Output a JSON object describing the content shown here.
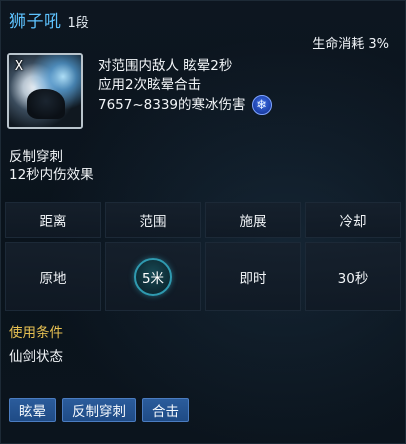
{
  "skill": {
    "name": "狮子吼",
    "level": "1段",
    "hp_cost": "生命消耗 3%",
    "icon_key": "X",
    "icon_name": "lion-roar-skill-icon",
    "description": [
      "对范围内敌人 眩晕2秒",
      "应用2次眩晕合击",
      "7657~8339的寒冰伤害"
    ],
    "damage_element_icon": "frost-icon",
    "effect_lines": [
      "反制穿刺",
      "12秒内伤效果"
    ]
  },
  "stats": {
    "headers": [
      "距离",
      "范围",
      "施展",
      "冷却"
    ],
    "values": [
      "原地",
      "5米",
      "即时",
      "30秒"
    ]
  },
  "condition": {
    "title": "使用条件",
    "text": "仙剑状态"
  },
  "tags": [
    "眩晕",
    "反制穿刺",
    "合击"
  ],
  "colors": {
    "skill_name": "#5ec3ff",
    "condition_title": "#e7c152",
    "tag_bg": "#2b5c9c",
    "range_badge_border": "#2f9ab0",
    "frost_icon": "#3d6ee6"
  }
}
